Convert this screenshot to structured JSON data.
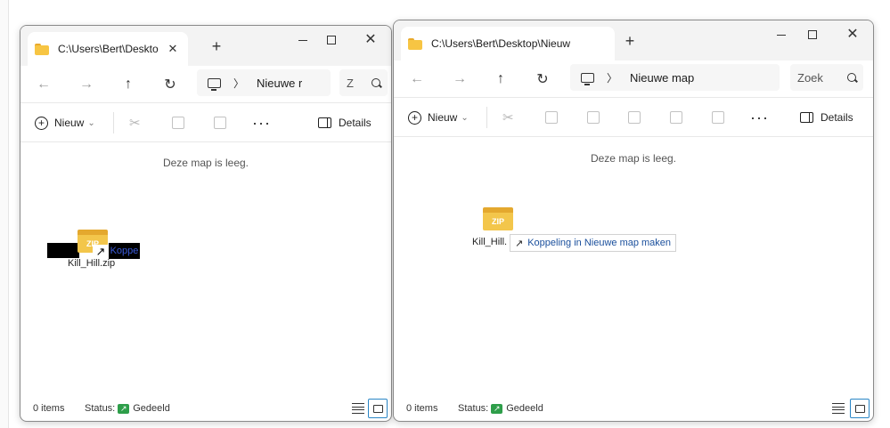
{
  "window_left": {
    "tab_title": "C:\\Users\\Bert\\Deskto",
    "address_crumb": "Nieuwe r",
    "search_placeholder": "Z",
    "toolbar": {
      "new_label": "Nieuw",
      "details_label": "Details"
    },
    "empty_message": "Deze map is leeg.",
    "file": {
      "name": "Kill_Hill.zip",
      "icon_text": "ZIP",
      "drag_label": "Koppe"
    },
    "status": {
      "items": "0 items",
      "status_label": "Status:",
      "status_value": "Gedeeld"
    }
  },
  "window_right": {
    "tab_title": "C:\\Users\\Bert\\Desktop\\Nieuw",
    "address_crumb": "Nieuwe map",
    "search_placeholder": "Zoek",
    "toolbar": {
      "new_label": "Nieuw",
      "details_label": "Details"
    },
    "empty_message": "Deze map is leeg.",
    "file": {
      "name": "Kill_Hill.",
      "icon_text": "ZIP"
    },
    "drag_tooltip": "Koppeling in Nieuwe map maken",
    "status": {
      "items": "0 items",
      "status_label": "Status:",
      "status_value": "Gedeeld"
    }
  },
  "icons": {
    "close": "✕",
    "plus": "+",
    "back": "←",
    "forward": "→",
    "up": "↑",
    "refresh": "↻",
    "chevron": "〉",
    "more": "···",
    "link_arrow": "↗",
    "shared": "↗",
    "cut": "✂",
    "dropdown": "⌄"
  },
  "colors": {
    "folder": "#f7c543",
    "zip": "#f3c64b",
    "shared": "#2e9e4a",
    "link_text": "#1a4f9c",
    "active_view": "#2a86c6"
  }
}
